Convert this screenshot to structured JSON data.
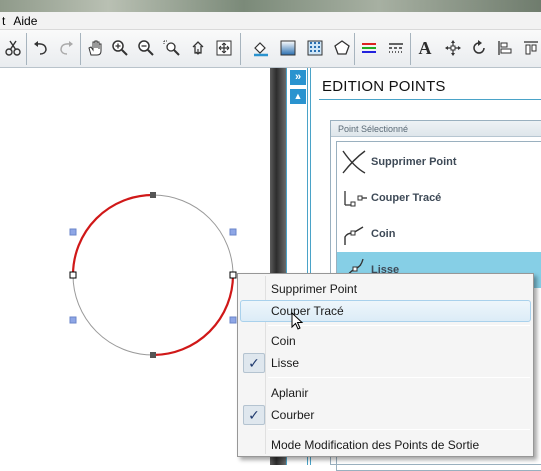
{
  "menubar": {
    "items": [
      "t",
      "Aide"
    ]
  },
  "toolbar": {
    "buttons": [
      "scissors-icon",
      "undo-icon",
      "redo-icon",
      "hand-icon",
      "zoom-in-icon",
      "zoom-out-icon",
      "zoom-select-icon",
      "zoom-page-icon",
      "fit-icon",
      "fill-icon",
      "gradient-icon",
      "pattern-icon",
      "shape-icon",
      "lines-icon",
      "dash-icon",
      "text-icon",
      "move-icon",
      "rotate-icon",
      "align-icon"
    ]
  },
  "side_strip": {
    "expand_label": "»",
    "up_label": "▲"
  },
  "panel": {
    "title": "EDITION POINTS",
    "group_title": "Point Sélectionné",
    "items": [
      {
        "label": "Supprimer Point",
        "icon": "delete-point-icon",
        "selected": false
      },
      {
        "label": "Couper Tracé",
        "icon": "cut-path-icon",
        "selected": false
      },
      {
        "label": "Coin",
        "icon": "corner-icon",
        "selected": false
      },
      {
        "label": "Lisse",
        "icon": "smooth-icon",
        "selected": true
      }
    ]
  },
  "context_menu": {
    "items": [
      {
        "label": "Supprimer Point",
        "checked": false
      },
      {
        "label": "Couper Tracé",
        "checked": false,
        "hover": true
      },
      {
        "label": "Coin",
        "checked": false
      },
      {
        "label": "Lisse",
        "checked": true
      },
      {
        "label": "Aplanir",
        "checked": false
      },
      {
        "label": "Courber",
        "checked": true
      },
      {
        "label": "Mode Modification des Points de Sortie",
        "checked": false
      }
    ],
    "check_glyph": "✓"
  },
  "colors": {
    "accent": "#2a93cf",
    "selection": "#86cfe6",
    "curve_red": "#d01818",
    "curve_gray": "#9a9a9a"
  }
}
